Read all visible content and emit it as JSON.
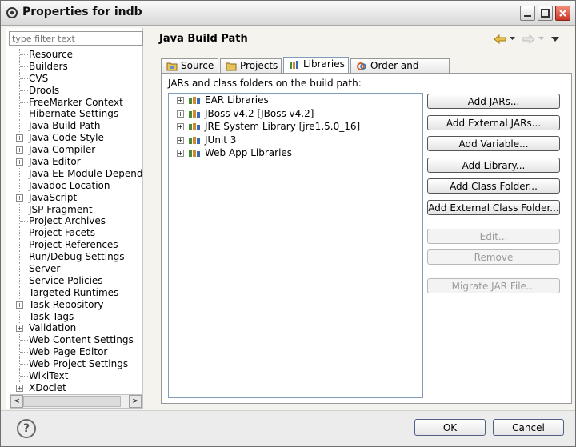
{
  "window": {
    "title": "Properties for indb"
  },
  "filter": {
    "placeholder": "type filter text"
  },
  "sidebar": {
    "items": [
      {
        "label": "Resource",
        "expandable": false
      },
      {
        "label": "Builders",
        "expandable": false
      },
      {
        "label": "CVS",
        "expandable": false
      },
      {
        "label": "Drools",
        "expandable": false
      },
      {
        "label": "FreeMarker Context",
        "expandable": false
      },
      {
        "label": "Hibernate Settings",
        "expandable": false
      },
      {
        "label": "Java Build Path",
        "expandable": false,
        "selected": true
      },
      {
        "label": "Java Code Style",
        "expandable": true
      },
      {
        "label": "Java Compiler",
        "expandable": true
      },
      {
        "label": "Java Editor",
        "expandable": true
      },
      {
        "label": "Java EE Module Depende",
        "expandable": false
      },
      {
        "label": "Javadoc Location",
        "expandable": false
      },
      {
        "label": "JavaScript",
        "expandable": true
      },
      {
        "label": "JSP Fragment",
        "expandable": false
      },
      {
        "label": "Project Archives",
        "expandable": false
      },
      {
        "label": "Project Facets",
        "expandable": false
      },
      {
        "label": "Project References",
        "expandable": false
      },
      {
        "label": "Run/Debug Settings",
        "expandable": false
      },
      {
        "label": "Server",
        "expandable": false
      },
      {
        "label": "Service Policies",
        "expandable": false
      },
      {
        "label": "Targeted Runtimes",
        "expandable": false
      },
      {
        "label": "Task Repository",
        "expandable": true
      },
      {
        "label": "Task Tags",
        "expandable": false
      },
      {
        "label": "Validation",
        "expandable": true
      },
      {
        "label": "Web Content Settings",
        "expandable": false
      },
      {
        "label": "Web Page Editor",
        "expandable": false
      },
      {
        "label": "Web Project Settings",
        "expandable": false
      },
      {
        "label": "WikiText",
        "expandable": false
      },
      {
        "label": "XDoclet",
        "expandable": true
      }
    ],
    "scroll_left_glyph": "<",
    "scroll_right_glyph": ">"
  },
  "main": {
    "title": "Java Build Path",
    "tabs": [
      {
        "label": "Source",
        "icon": "source-folder-icon"
      },
      {
        "label": "Projects",
        "icon": "projects-icon"
      },
      {
        "label": "Libraries",
        "icon": "libraries-icon",
        "active": true
      },
      {
        "label": "Order and Export",
        "icon": "order-export-icon"
      }
    ],
    "panel_label": "JARs and class folders on the build path:",
    "libraries": [
      "EAR Libraries",
      "JBoss v4.2 [JBoss v4.2]",
      "JRE System Library [jre1.5.0_16]",
      "JUnit 3",
      "Web App Libraries"
    ],
    "buttons": [
      {
        "label": "Add JARs...",
        "enabled": true
      },
      {
        "label": "Add External JARs...",
        "enabled": true
      },
      {
        "label": "Add Variable...",
        "enabled": true
      },
      {
        "label": "Add Library...",
        "enabled": true
      },
      {
        "label": "Add Class Folder...",
        "enabled": true
      },
      {
        "label": "Add External Class Folder...",
        "enabled": true
      },
      {
        "label": "Edit...",
        "enabled": false
      },
      {
        "label": "Remove",
        "enabled": false
      },
      {
        "label": "Migrate JAR File...",
        "enabled": false
      }
    ]
  },
  "footer": {
    "help_glyph": "?",
    "ok_label": "OK",
    "cancel_label": "Cancel"
  },
  "colors": {
    "accent_blue": "#7f9db9",
    "library_icon_green": "#4a8a3c",
    "library_icon_orange": "#d08a2a"
  }
}
